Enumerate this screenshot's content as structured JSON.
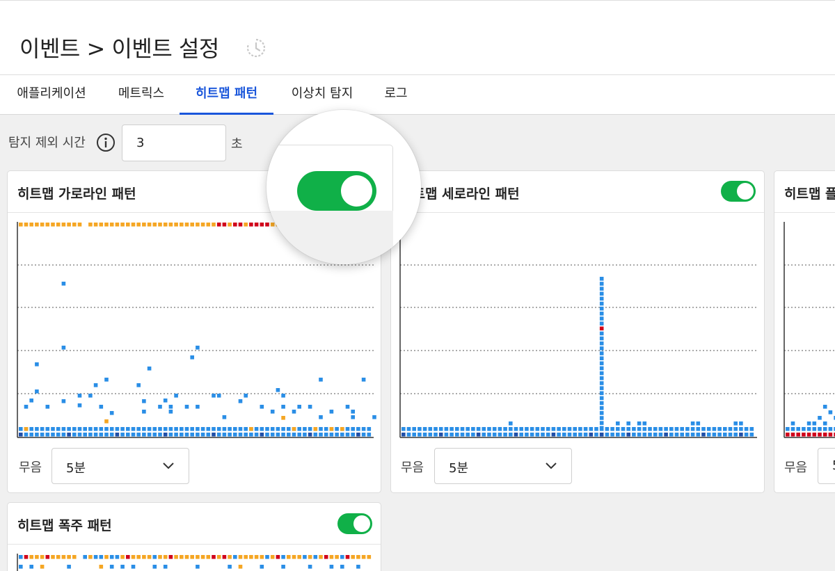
{
  "header": {
    "breadcrumb": "이벤트 > 이벤트 설정",
    "history_icon": "history-icon"
  },
  "tabs": [
    {
      "label": "애플리케이션",
      "active": false
    },
    {
      "label": "메트릭스",
      "active": false
    },
    {
      "label": "히트맵 패턴",
      "active": true
    },
    {
      "label": "이상치 탐지",
      "active": false
    },
    {
      "label": "로그",
      "active": false
    }
  ],
  "filter": {
    "label": "탐지 제외 시간",
    "value": "3",
    "unit": "초",
    "info_icon": "info-icon"
  },
  "colors": {
    "accent": "#1a56db",
    "toggle_on": "#10b048",
    "cell_blue": "#2a8ee6",
    "cell_dark_blue": "#1f4fa8",
    "cell_orange": "#f5a623",
    "cell_red": "#d0021b",
    "cell_dark_red": "#a8001a"
  },
  "cards": [
    {
      "title": "히트맵 가로라인 패턴",
      "toggle_on": true,
      "select_label": "무음",
      "select_value": "5분"
    },
    {
      "title": "히트맵 세로라인 패턴",
      "toggle_on": true,
      "select_label": "무음",
      "select_value": "5분"
    },
    {
      "title": "히트맵 플",
      "toggle_on": true,
      "select_label": "무음",
      "select_value": "5"
    },
    {
      "title": "히트맵 폭주 패턴",
      "toggle_on": true
    }
  ]
}
